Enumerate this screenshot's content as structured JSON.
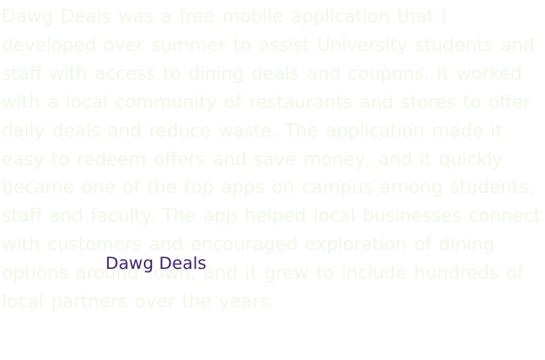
{
  "content": {
    "background_text": "Dawg Deals was a free mobile application that I developed over summer to assist University students and staff with access to dining deals and coupons. It worked with a local community of restaurants and stores to offer daily deals and reduce waste. The application made it easy to redeem offers and save money, and it quickly became one of the top apps on campus among students, staff and faculty. The app helped local businesses connect with customers and encouraged exploration of dining options around town, and it grew to include hundreds of local partners over the years.",
    "link_label": "Dawg Deals",
    "link_color": "#3d2370",
    "background_text_color": "#f1f7e8"
  }
}
